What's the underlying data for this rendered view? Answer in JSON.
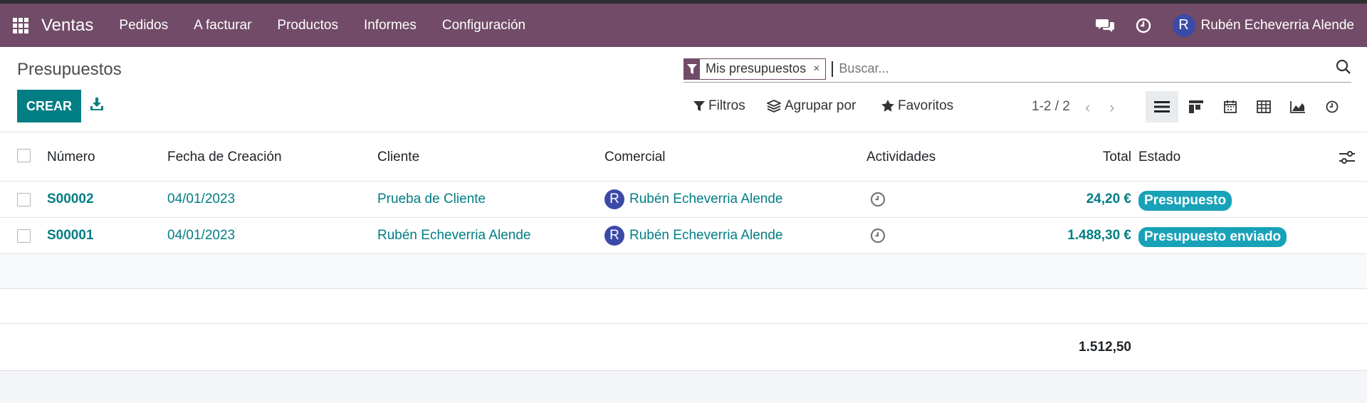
{
  "navbar": {
    "app_name": "Ventas",
    "menu": [
      "Pedidos",
      "A facturar",
      "Productos",
      "Informes",
      "Configuración"
    ],
    "user_initial": "R",
    "user_name": "Rubén Echeverria Alende"
  },
  "control": {
    "title": "Presupuestos",
    "create_label": "CREAR",
    "facet_label": "Mis presupuestos",
    "facet_remove": "×",
    "search_placeholder": "Buscar...",
    "filters_label": "Filtros",
    "groupby_label": "Agrupar por",
    "favorites_label": "Favoritos",
    "pager": "1-2 / 2"
  },
  "list": {
    "headers": {
      "numero": "Número",
      "fecha": "Fecha de Creación",
      "cliente": "Cliente",
      "comercial": "Comercial",
      "actividades": "Actividades",
      "total": "Total",
      "estado": "Estado"
    },
    "rows": [
      {
        "numero": "S00002",
        "fecha": "04/01/2023",
        "cliente": "Prueba de Cliente",
        "avatar": "R",
        "comercial": "Rubén Echeverria Alende",
        "total": "24,20 €",
        "estado": "Presupuesto"
      },
      {
        "numero": "S00001",
        "fecha": "04/01/2023",
        "cliente": "Rubén Echeverria Alende",
        "avatar": "R",
        "comercial": "Rubén Echeverria Alende",
        "total": "1.488,30 €",
        "estado": "Presupuesto enviado"
      }
    ],
    "sum_total": "1.512,50"
  },
  "colors": {
    "brand": "#714b67",
    "primary": "#017e84",
    "badge": "#17a2b8"
  }
}
